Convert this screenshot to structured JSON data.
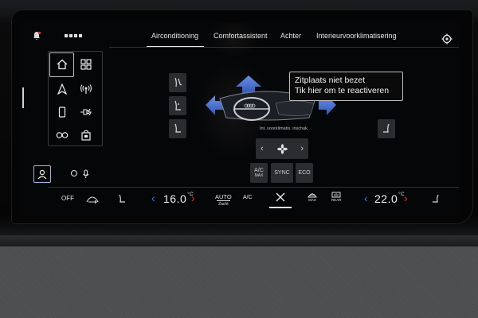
{
  "tabs": [
    {
      "label": "Airconditioning",
      "active": true
    },
    {
      "label": "Comfortassistent",
      "active": false
    },
    {
      "label": "Achter",
      "active": false
    },
    {
      "label": "Interieurvoorklimatisering",
      "active": false
    }
  ],
  "tooltip": {
    "line1": "Zitplaats niet bezet",
    "line2": "Tik hier om te reactiveren"
  },
  "dash_label": "Int. voorklimatis. inschak.",
  "modes": {
    "ac": "A/C",
    "ac_sub": "MAX",
    "sync": "SYNC",
    "eco": "ECO"
  },
  "bottom": {
    "off": "OFF",
    "left_temp": "16.0",
    "left_unit": "°C",
    "auto": "AUTO",
    "auto_sub": "Zacht",
    "ac": "A/C",
    "max": "MAX",
    "rear": "REAR",
    "right_temp": "22.0",
    "right_unit": "°C"
  },
  "colors": {
    "cold": "#3d7ff5",
    "hot": "#e8342c",
    "airflow": "#4f78d6"
  }
}
